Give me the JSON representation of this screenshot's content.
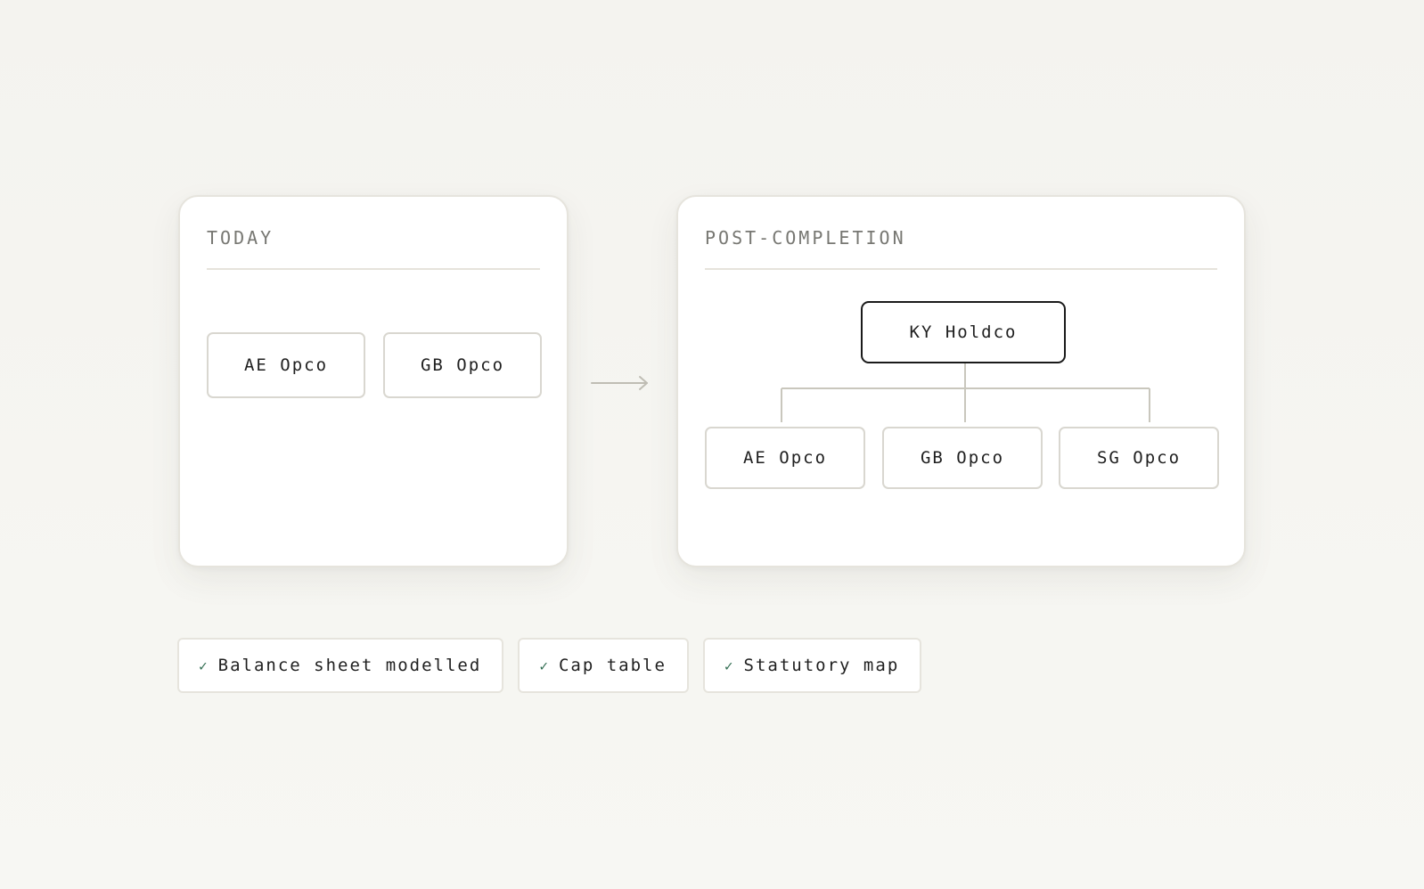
{
  "today": {
    "title": "TODAY",
    "entities": [
      "AE Opco",
      "GB Opco"
    ]
  },
  "post_completion": {
    "title": "POST-COMPLETION",
    "holdco": "KY Holdco",
    "entities": [
      "AE Opco",
      "GB Opco",
      "SG Opco"
    ]
  },
  "transition_icon": "arrow-right-icon",
  "checklist": [
    {
      "icon": "check-icon",
      "label": "Balance sheet modelled"
    },
    {
      "icon": "check-icon",
      "label": "Cap table"
    },
    {
      "icon": "check-icon",
      "label": "Statutory map"
    }
  ],
  "colors": {
    "background": "#f5f4f0",
    "card": "#ffffff",
    "card_border": "#e6e4dd",
    "holdco_border": "#1a1a1a",
    "connector": "#c9c7bd",
    "check": "#2e6b4f",
    "muted_text": "#777772"
  }
}
